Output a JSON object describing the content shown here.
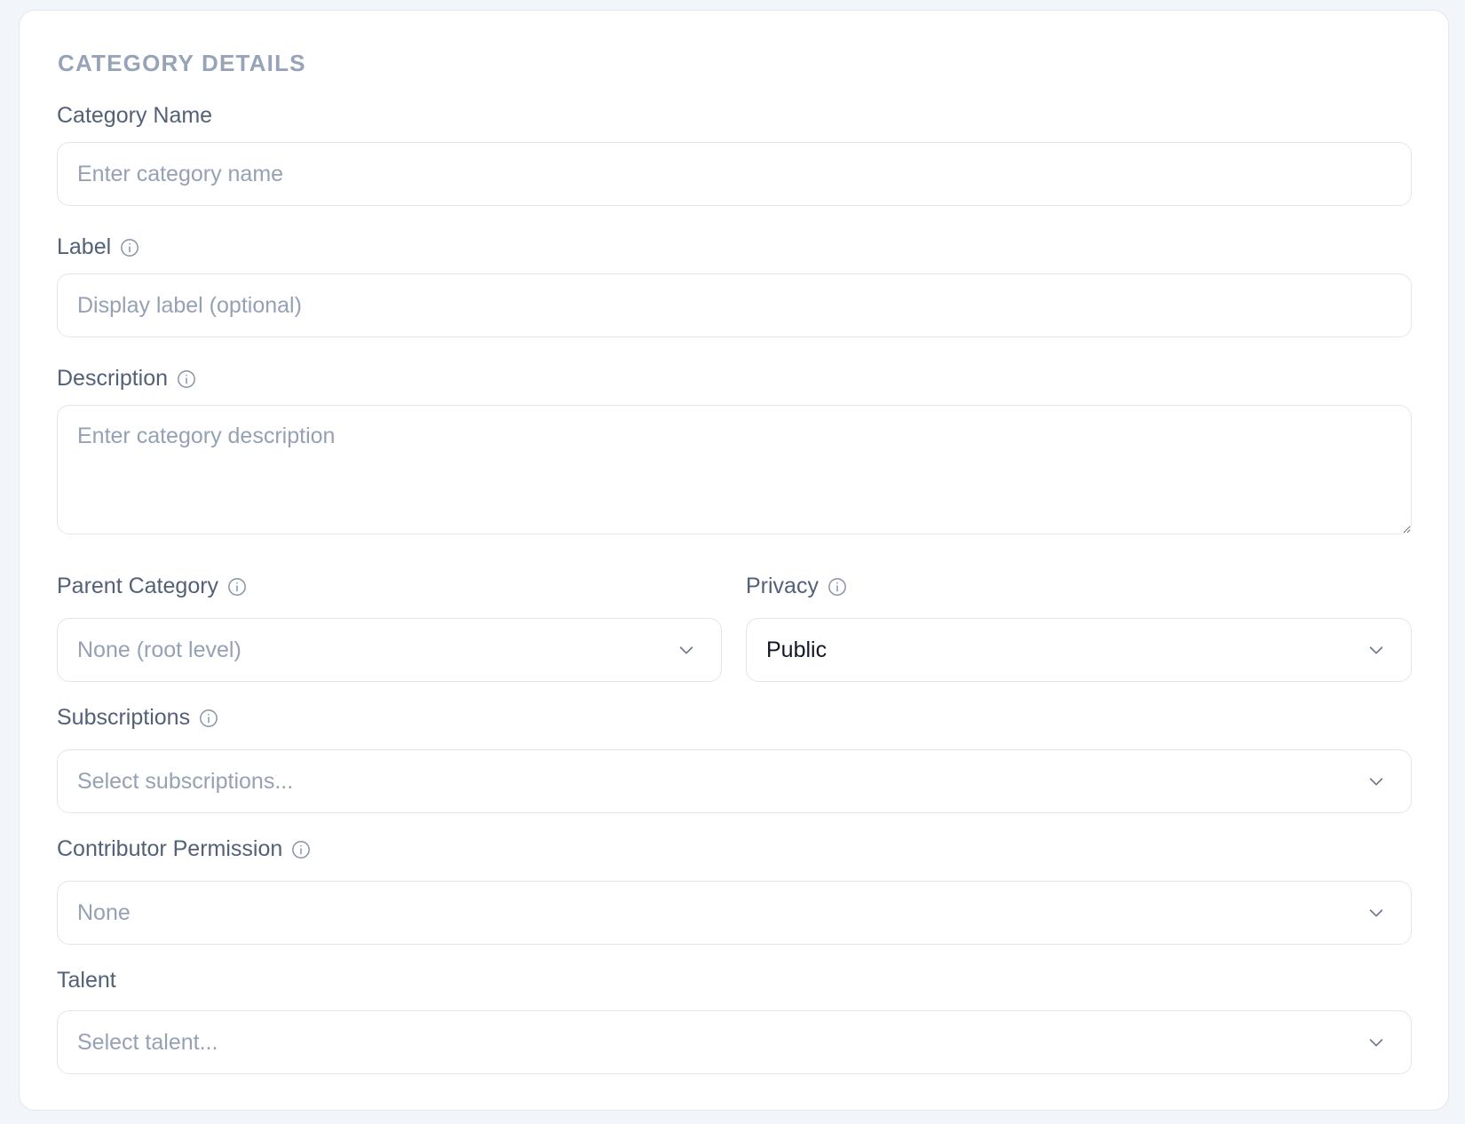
{
  "section": {
    "title": "CATEGORY DETAILS"
  },
  "fields": {
    "category_name": {
      "label": "Category Name",
      "placeholder": "Enter category name",
      "value": ""
    },
    "label": {
      "label": "Label",
      "placeholder": "Display label (optional)",
      "value": ""
    },
    "description": {
      "label": "Description",
      "placeholder": "Enter category description",
      "value": ""
    },
    "parent_category": {
      "label": "Parent Category",
      "selected": "None (root level)"
    },
    "privacy": {
      "label": "Privacy",
      "selected": "Public"
    },
    "subscriptions": {
      "label": "Subscriptions",
      "selected": "Select subscriptions..."
    },
    "contributor_permission": {
      "label": "Contributor Permission",
      "selected": "None"
    },
    "talent": {
      "label": "Talent",
      "selected": "Select talent..."
    }
  },
  "icons": {
    "info": "info-circle-icon",
    "dropdown": "chevron-down-icon"
  },
  "colors": {
    "page_bg": "#f2f5fa",
    "card_bg": "#ffffff",
    "section_title": "#97a3b6",
    "label_text": "#526177",
    "placeholder_text": "#95a1b4",
    "border": "#e1e6ee"
  }
}
